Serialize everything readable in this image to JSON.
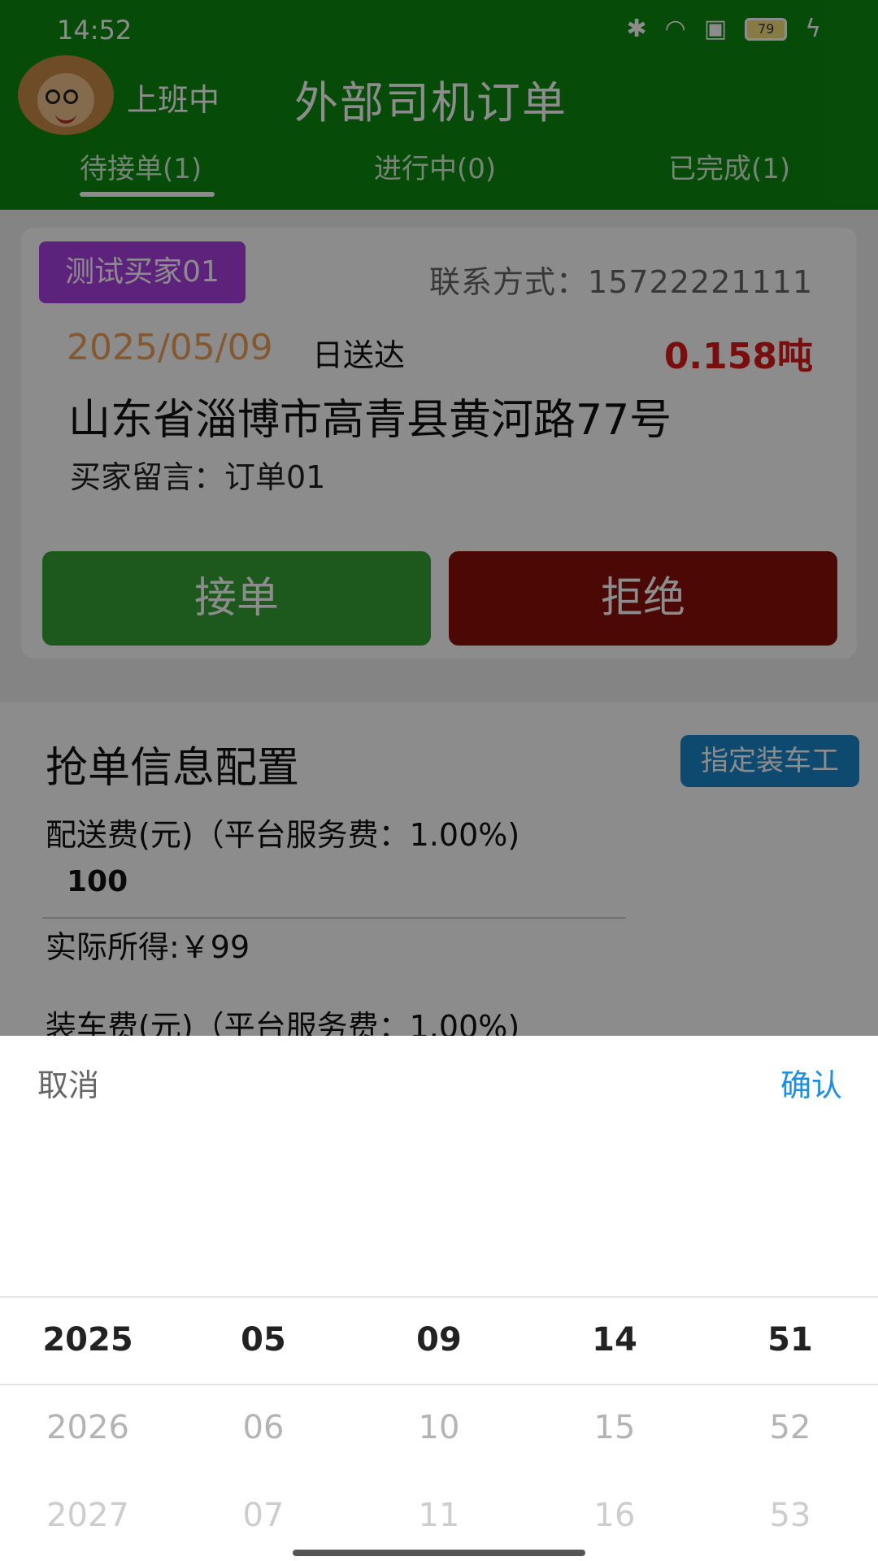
{
  "status_bar": {
    "time": "14:52",
    "battery": "79"
  },
  "header": {
    "duty_status": "上班中",
    "title": "外部司机订单",
    "tabs": [
      {
        "label": "待接单(1)",
        "active": true
      },
      {
        "label": "进行中(0)",
        "active": false
      },
      {
        "label": "已完成(1)",
        "active": false
      }
    ]
  },
  "order": {
    "buyer": "测试买家01",
    "contact": "联系方式：15722221111",
    "date": "2025/05/09",
    "date_suffix": "日送达",
    "weight": "0.158吨",
    "address": "山东省淄博市高青县黄河路77号",
    "message": "买家留言：订单01",
    "accept_label": "接单",
    "reject_label": "拒绝"
  },
  "config": {
    "title": "抢单信息配置",
    "assign_button": "指定装车工",
    "delivery_fee_label": "配送费(元)（平台服务费：1.00%)",
    "delivery_fee_value": "100",
    "actual_income": "实际所得:￥99",
    "loading_fee_label": "装车费(元)（平台服务费：1.00%)"
  },
  "picker": {
    "cancel_label": "取消",
    "confirm_label": "确认",
    "columns": [
      {
        "selected": "2025",
        "next1": "2026",
        "next2": "2027"
      },
      {
        "selected": "05",
        "next1": "06",
        "next2": "07"
      },
      {
        "selected": "09",
        "next1": "10",
        "next2": "11"
      },
      {
        "selected": "14",
        "next1": "15",
        "next2": "16"
      },
      {
        "selected": "51",
        "next1": "52",
        "next2": "53"
      }
    ]
  },
  "colors": {
    "header_green": "#0c8a0f",
    "accept_green": "#36a336",
    "reject_red": "#8a1008",
    "buyer_tag_purple": "#a93ee0",
    "confirm_blue": "#1d8ee0",
    "weight_red": "#dd1b1b",
    "date_orange": "#f0a25a"
  }
}
